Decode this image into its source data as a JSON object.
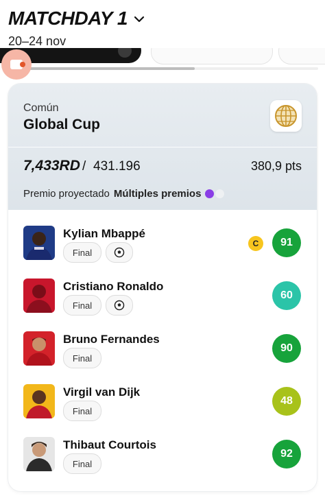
{
  "header": {
    "title": "MATCHDAY 1",
    "dates": "20–24 nov"
  },
  "tabs": {
    "progress_fraction": 0.6
  },
  "league": {
    "type": "Común",
    "name": "Global Cup",
    "rank": "7,433RD",
    "separator": "/",
    "total": "431.196",
    "points": "380,9 pts",
    "prize_label": "Premio proyectado",
    "prize_value": "Múltiples premios"
  },
  "players": [
    {
      "name": "Kylian Mbappé",
      "status": "Final",
      "has_ball": true,
      "captain": "C",
      "score": "91",
      "score_color": "#17a33b"
    },
    {
      "name": "Cristiano Ronaldo",
      "status": "Final",
      "has_ball": true,
      "captain": "",
      "score": "60",
      "score_color": "#2bc4a8"
    },
    {
      "name": "Bruno Fernandes",
      "status": "Final",
      "has_ball": false,
      "captain": "",
      "score": "90",
      "score_color": "#17a33b"
    },
    {
      "name": "Virgil van Dijk",
      "status": "Final",
      "has_ball": false,
      "captain": "",
      "score": "48",
      "score_color": "#a8c21a"
    },
    {
      "name": "Thibaut Courtois",
      "status": "Final",
      "has_ball": false,
      "captain": "",
      "score": "92",
      "score_color": "#17a33b"
    }
  ],
  "colors": {
    "accent_purple": "#8a3ee6",
    "captain_yellow": "#f7c51e",
    "share_orange": "#e2562a"
  }
}
